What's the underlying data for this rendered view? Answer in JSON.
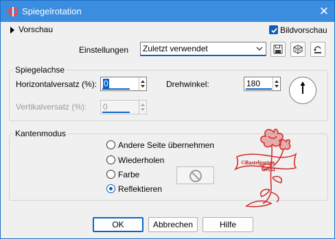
{
  "window": {
    "title": "Spiegelrotation",
    "close_glyph": "✕"
  },
  "preview": {
    "label": "Vorschau",
    "bildvorschau_label": "Bildvorschau",
    "bildvorschau_checked": true
  },
  "settings": {
    "label": "Einstellungen",
    "value": "Zuletzt verwendet"
  },
  "mirror_axis": {
    "title": "Spiegelachse",
    "h_offset_label": "Horizontalversatz (%):",
    "h_offset_value": "0",
    "v_offset_label": "Vertikalversatz (%):",
    "v_offset_value": "0",
    "rotation_label": "Drehwinkel:",
    "rotation_value": "180"
  },
  "edge_mode": {
    "title": "Kantenmodus",
    "options": [
      {
        "label": "Andere Seite übernehmen",
        "checked": false
      },
      {
        "label": "Wiederholen",
        "checked": false
      },
      {
        "label": "Farbe",
        "checked": false
      },
      {
        "label": "Reflektieren",
        "checked": true
      }
    ]
  },
  "buttons": {
    "ok": "OK",
    "cancel": "Abbrechen",
    "help": "Hilfe"
  },
  "watermark": {
    "text_line1": "©Bastelgarten",
    "text_line2": "Wiza"
  },
  "colors": {
    "titlebar": "#3b8de0",
    "accent": "#0d5cb6",
    "watermark_red": "#d32f2f"
  }
}
